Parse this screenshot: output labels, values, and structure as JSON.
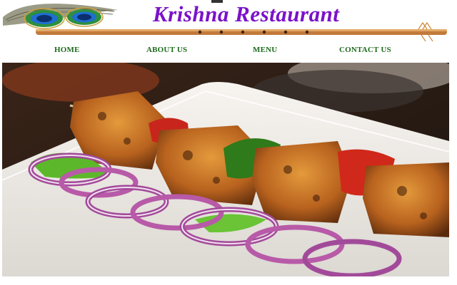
{
  "site": {
    "title": "Krishna Restaurant"
  },
  "nav": {
    "items": [
      {
        "label": "HOME"
      },
      {
        "label": "ABOUT US"
      },
      {
        "label": "MENU"
      },
      {
        "label": "CONTACT US"
      }
    ]
  },
  "hero": {
    "image": "paneer-tikka-skewer-photo"
  },
  "colors": {
    "title": "#7a12c9",
    "nav": "#1d6b1d",
    "flute": "#c27a3a"
  }
}
